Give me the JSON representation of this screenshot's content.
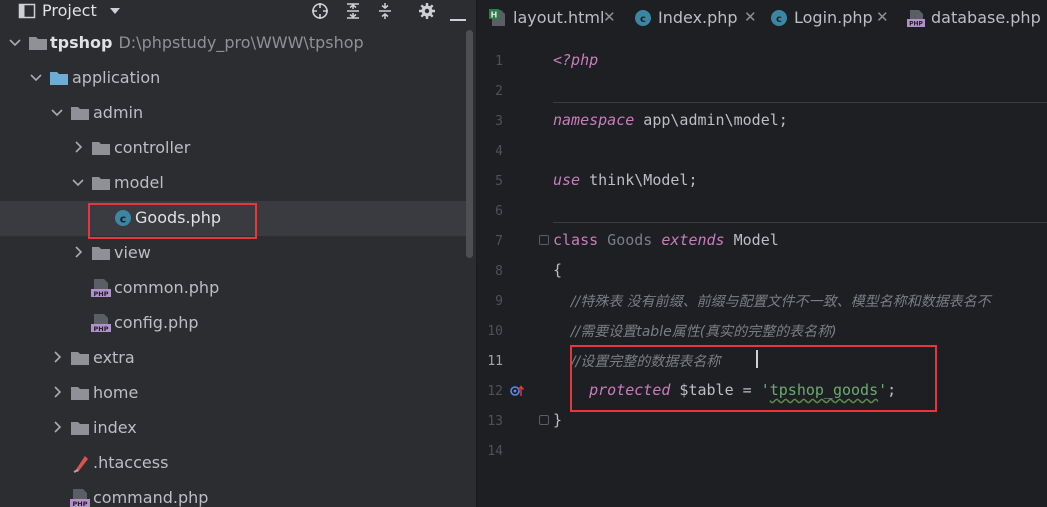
{
  "project_panel": {
    "title": "Project",
    "toolbar_icons": [
      "crosshair-icon",
      "expand-all-icon",
      "collapse-all-icon",
      "gear-icon",
      "minimize-icon"
    ],
    "tree": [
      {
        "label": "tpshop",
        "path": "D:\\phpstudy_pro\\WWW\\tpshop",
        "type": "folder",
        "expanded": true
      },
      {
        "label": "application",
        "type": "folder",
        "expanded": true
      },
      {
        "label": "admin",
        "type": "folder",
        "expanded": true
      },
      {
        "label": "controller",
        "type": "folder",
        "expanded": false
      },
      {
        "label": "model",
        "type": "folder",
        "expanded": true
      },
      {
        "label": "Goods.php",
        "type": "php-class",
        "selected": true
      },
      {
        "label": "view",
        "type": "folder",
        "expanded": false
      },
      {
        "label": "common.php",
        "type": "php-file"
      },
      {
        "label": "config.php",
        "type": "php-file"
      },
      {
        "label": "extra",
        "type": "folder",
        "expanded": false
      },
      {
        "label": "home",
        "type": "folder",
        "expanded": false
      },
      {
        "label": "index",
        "type": "folder",
        "expanded": false
      },
      {
        "label": ".htaccess",
        "type": "htaccess-file"
      },
      {
        "label": "command.php",
        "type": "php-file"
      }
    ]
  },
  "editor": {
    "tabs": [
      {
        "label": "layout.html",
        "icon": "html-file-icon",
        "active": false
      },
      {
        "label": "Index.php",
        "icon": "php-class-icon",
        "active": false
      },
      {
        "label": "Login.php",
        "icon": "php-class-icon",
        "active": false
      },
      {
        "label": "database.php",
        "icon": "php-file-icon",
        "active": false
      }
    ],
    "current_line": 11,
    "lines": [
      {
        "n": "1",
        "text": "<?php"
      },
      {
        "n": "2",
        "text": ""
      },
      {
        "n": "3",
        "kw": "namespace",
        "rest": " app\\admin\\model;"
      },
      {
        "n": "4",
        "text": ""
      },
      {
        "n": "5",
        "kw": "use",
        "rest": " think\\Model;"
      },
      {
        "n": "6",
        "text": ""
      },
      {
        "n": "7",
        "kw": "class",
        "name": " Goods ",
        "kw2": "extends",
        "rest": " Model"
      },
      {
        "n": "8",
        "text": "{"
      },
      {
        "n": "9",
        "comment": "    //特殊表 没有前缀、前缀与配置文件不一致、模型名称和数据表名不"
      },
      {
        "n": "10",
        "comment": "    //需要设置table属性(真实的完整的表名称)"
      },
      {
        "n": "11",
        "comment": "    //设置完整的数据表名称"
      },
      {
        "n": "12",
        "kw": "    protected",
        "var": " $table",
        "eq": " = ",
        "str_q1": "'",
        "str": "tpshop_goods",
        "str_q2": "'",
        "end": ";"
      },
      {
        "n": "13",
        "text": "}"
      },
      {
        "n": "14",
        "text": ""
      }
    ]
  },
  "colors": {
    "highlight_border": "#e5373c",
    "keyword": "#c77dbb",
    "string": "#6aab73",
    "comment": "#7a7e85",
    "editor_bg": "#1e1f22",
    "panel_bg": "#2b2d30"
  }
}
